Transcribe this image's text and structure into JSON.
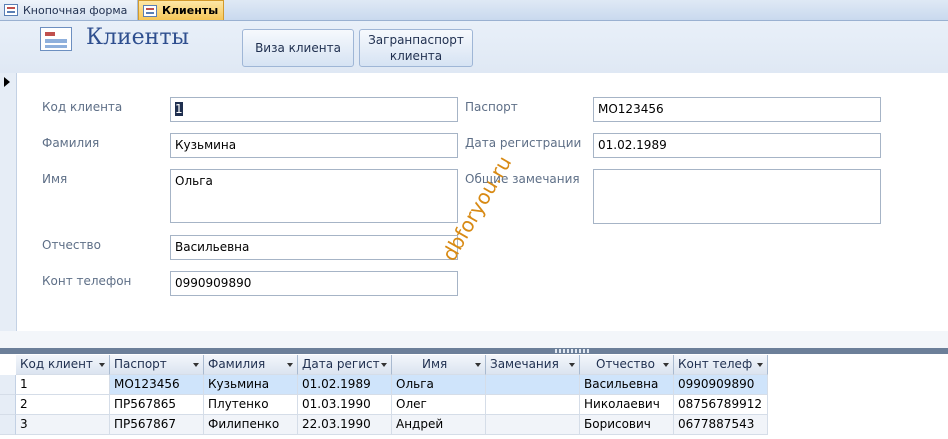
{
  "tabs": [
    {
      "label": "Кнопочная форма",
      "active": false
    },
    {
      "label": "Клиенты",
      "active": true
    }
  ],
  "header": {
    "title": "Клиенты",
    "buttons": {
      "visa": "Виза клиента",
      "passport_line1": "Загранпаспорт",
      "passport_line2": "клиента"
    }
  },
  "form": {
    "labels": {
      "client_code": "Код клиента",
      "surname": "Фамилия",
      "name": "Имя",
      "patronymic": "Отчество",
      "phone": "Конт телефон",
      "passport": "Паспорт",
      "reg_date": "Дата регистрации",
      "remarks": "Общие замечания"
    },
    "values": {
      "client_code": "1",
      "surname": "Кузьмина",
      "name": "Ольга",
      "patronymic": "Васильевна",
      "phone": "0990909890",
      "passport": "МО123456",
      "reg_date": "01.02.1989",
      "remarks": ""
    }
  },
  "watermark": "dbforyou.ru",
  "datasheet": {
    "columns": [
      "Код клиент",
      "Паспорт",
      "Фамилия",
      "Дата регист",
      "Имя",
      "Замечания",
      "Отчество",
      "Конт телеф"
    ],
    "rows": [
      [
        "1",
        "МО123456",
        "Кузьмина",
        "01.02.1989",
        "Ольга",
        "",
        "Васильевна",
        "0990909890"
      ],
      [
        "2",
        "ПР567865",
        "Плутенко",
        "01.03.1990",
        "Олег",
        "",
        "Николаевич",
        "08756789912"
      ],
      [
        "3",
        "ПР567867",
        "Филипенко",
        "22.03.1990",
        "Андрей",
        "",
        "Борисович",
        "0677887543"
      ]
    ],
    "selected_row": 0
  },
  "colors": {
    "active_tab": "#f6c657",
    "title": "#2f4f8f",
    "selected_row": "#cfe4fb",
    "watermark": "#d88a14"
  }
}
